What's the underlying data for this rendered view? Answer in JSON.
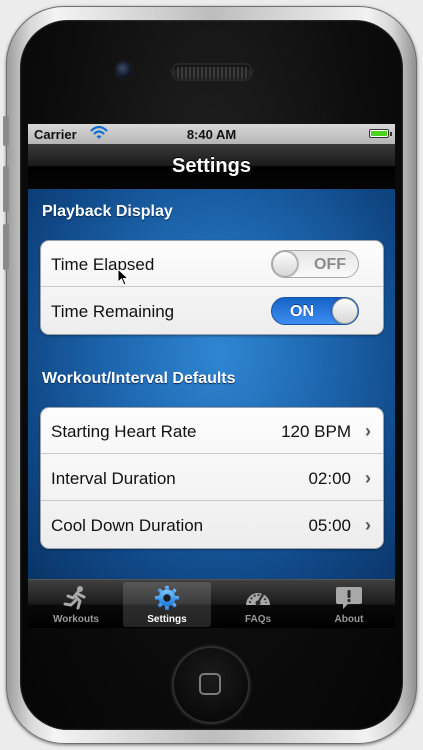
{
  "status_bar": {
    "carrier": "Carrier",
    "time": "8:40 AM",
    "battery_level": 1.0,
    "battery_color": "#4bd31e"
  },
  "nav": {
    "title": "Settings"
  },
  "sections": [
    {
      "header": "Playback Display",
      "rows": [
        {
          "label": "Time Elapsed",
          "toggle": "OFF"
        },
        {
          "label": "Time Remaining",
          "toggle": "ON"
        }
      ]
    },
    {
      "header": "Workout/Interval Defaults",
      "rows": [
        {
          "label": "Starting Heart Rate",
          "value": "120 BPM"
        },
        {
          "label": "Interval Duration",
          "value": "02:00"
        },
        {
          "label": "Cool Down Duration",
          "value": "05:00"
        }
      ]
    }
  ],
  "tabs": [
    {
      "label": "Workouts",
      "icon": "runner-icon",
      "selected": false
    },
    {
      "label": "Settings",
      "icon": "gear-icon",
      "selected": true
    },
    {
      "label": "FAQs",
      "icon": "gauge-icon",
      "selected": false
    },
    {
      "label": "About",
      "icon": "speech-bubble-icon",
      "selected": false
    }
  ],
  "colors": {
    "accent": "#1a6fd6",
    "background": "#1d66ae",
    "toggle_on": "#2a78e0"
  }
}
